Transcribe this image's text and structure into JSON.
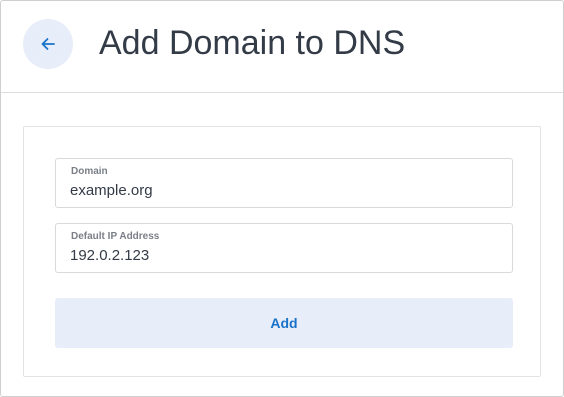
{
  "header": {
    "back_icon": "arrow-left-icon",
    "title": "Add Domain to DNS"
  },
  "form": {
    "domain": {
      "label": "Domain",
      "value": "example.org"
    },
    "ip_address": {
      "label": "Default IP Address",
      "value": "192.0.2.123"
    },
    "submit_label": "Add"
  },
  "colors": {
    "accent": "#1a73c8",
    "button_background": "#e7edf9",
    "title_text": "#333b47",
    "field_label": "#7a7f87"
  }
}
